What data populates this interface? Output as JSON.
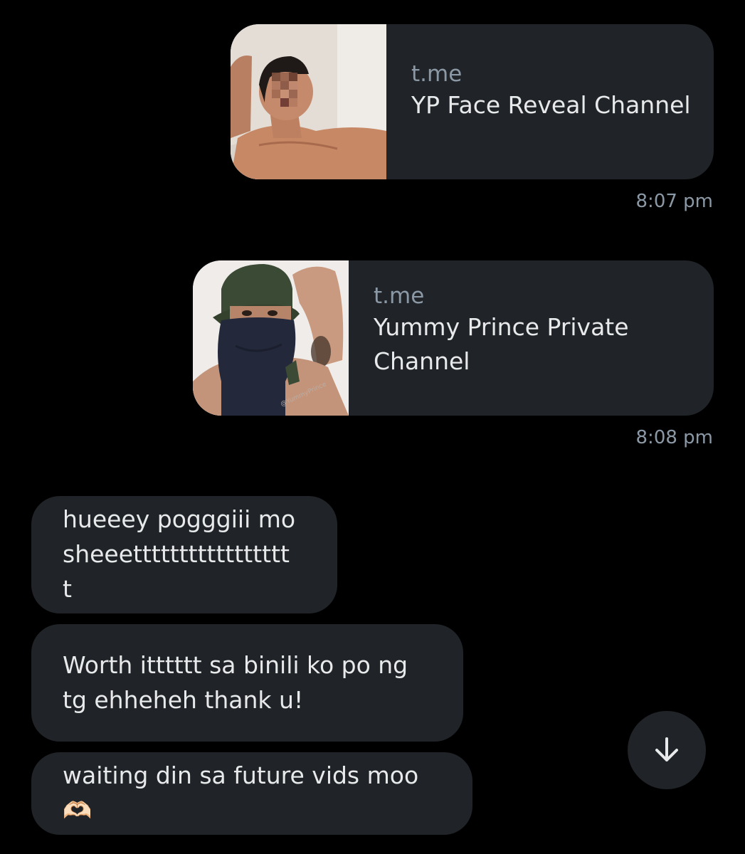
{
  "messages_sent": [
    {
      "domain": "t.me",
      "title": "YP Face Reveal Channel",
      "time": "8:07 pm"
    },
    {
      "domain": "t.me",
      "title": "Yummy Prince Private Channel",
      "time": "8:08 pm",
      "thumbnail_watermark": "@YummyPrince"
    }
  ],
  "messages_received": [
    {
      "text": "hueeey pogggiii mo sheeetttttttttttttttttt"
    },
    {
      "text": "Worth itttttt sa binili ko po ng tg ehheheh thank u!"
    },
    {
      "text": "waiting din sa future vids moo🫶🏻"
    }
  ],
  "scroll_button": {
    "icon": "arrow-down-icon"
  },
  "colors": {
    "background": "#000000",
    "bubble": "#202327",
    "secondary_text": "#8b98a5",
    "primary_text": "#e7e9ea"
  }
}
